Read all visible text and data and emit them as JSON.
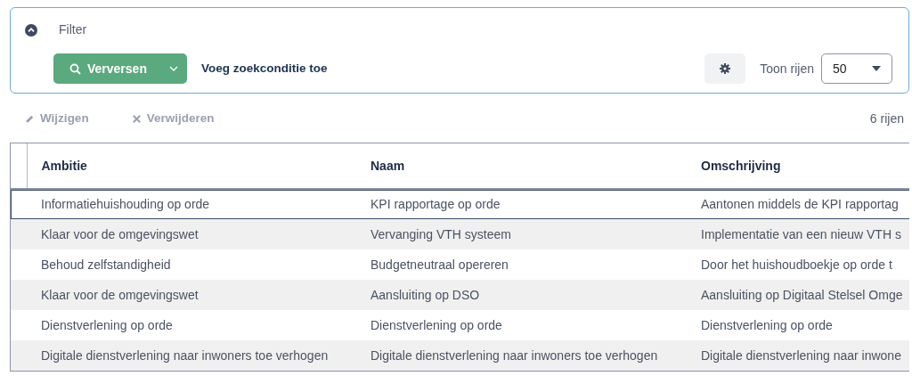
{
  "filter": {
    "title": "Filter",
    "expanded": true,
    "refresh_button": "Verversen",
    "add_condition": "Voeg zoekconditie toe",
    "rows_label": "Toon rijen",
    "rows_value": "50"
  },
  "toolbar": {
    "actions": [
      {
        "label": "Wijzigen",
        "kind": "edit",
        "disabled": true
      },
      {
        "label": "Verwijderen",
        "kind": "delete",
        "disabled": true
      }
    ],
    "count": "6 rijen"
  },
  "table": {
    "columns": [
      "Ambitie",
      "Naam",
      "Omschrijving"
    ],
    "rows": [
      {
        "selected": true,
        "cells": [
          "Informatiehuishouding op orde",
          "KPI rapportage op orde",
          "Aantonen middels de KPI rapportag"
        ]
      },
      {
        "selected": false,
        "cells": [
          "Klaar voor de omgevingswet",
          "Vervanging VTH systeem",
          "Implementatie van een nieuw VTH s"
        ]
      },
      {
        "selected": false,
        "cells": [
          "Behoud zelfstandigheid",
          "Budgetneutraal opereren",
          "Door het huishoudboekje op orde t"
        ]
      },
      {
        "selected": false,
        "cells": [
          "Klaar voor de omgevingswet",
          "Aansluiting op DSO",
          "Aansluiting op Digitaal Stelsel Omge"
        ]
      },
      {
        "selected": false,
        "cells": [
          "Dienstverlening op orde",
          "Dienstverlening op orde",
          "Dienstverlening op orde"
        ]
      },
      {
        "selected": false,
        "cells": [
          "Digitale dienstverlening naar inwoners toe verhogen",
          "Digitale dienstverlening naar inwoners toe verhogen",
          "Digitale dienstverlening naar inwone"
        ]
      }
    ]
  }
}
